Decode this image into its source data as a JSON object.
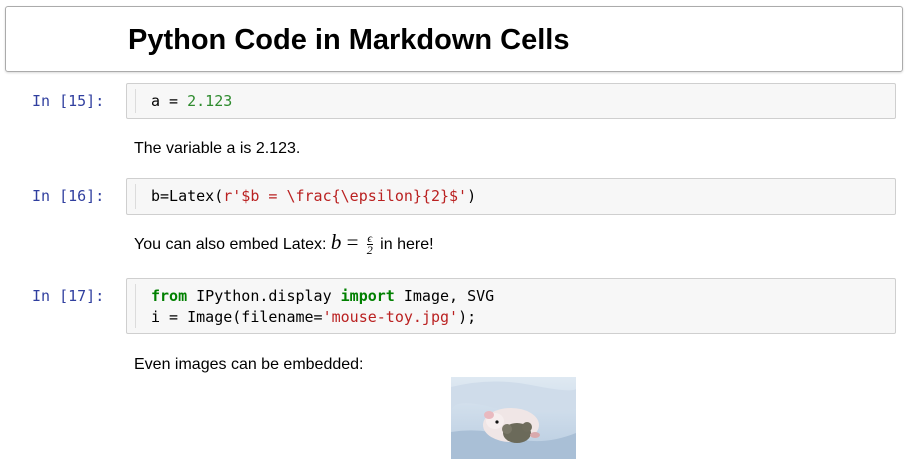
{
  "title_cell": {
    "heading": "Python Code in Markdown Cells"
  },
  "cells": [
    {
      "prompt": "In [15]:",
      "code": {
        "var": "a = ",
        "value": "2.123"
      }
    },
    {
      "prompt": "In [16]:",
      "code": {
        "pre": "b=Latex(",
        "string": "r'$b = \\frac{\\epsilon}{2}$'",
        "post": ")"
      }
    },
    {
      "prompt": "In [17]:",
      "code": {
        "kw1": "from",
        "mod": " IPython.display ",
        "kw2": "import",
        "names": " Image, SVG",
        "line2_pre": "i = Image(filename=",
        "line2_str": "'mouse-toy.jpg'",
        "line2_post": ");"
      }
    }
  ],
  "markdown": {
    "var_text": "The variable a is 2.123.",
    "latex_pre": "You can also embed Latex: ",
    "latex_b": "b",
    "latex_eq": " = ",
    "latex_num": "ϵ",
    "latex_den": "2",
    "latex_post": " in here!",
    "images_text": "Even images can be embedded:"
  },
  "image": {
    "icon": "mouse-toy-photo"
  },
  "colors": {
    "prompt": "#303f9f",
    "number": "#2e8b2e",
    "string": "#ba2121",
    "keyword": "#008000"
  }
}
